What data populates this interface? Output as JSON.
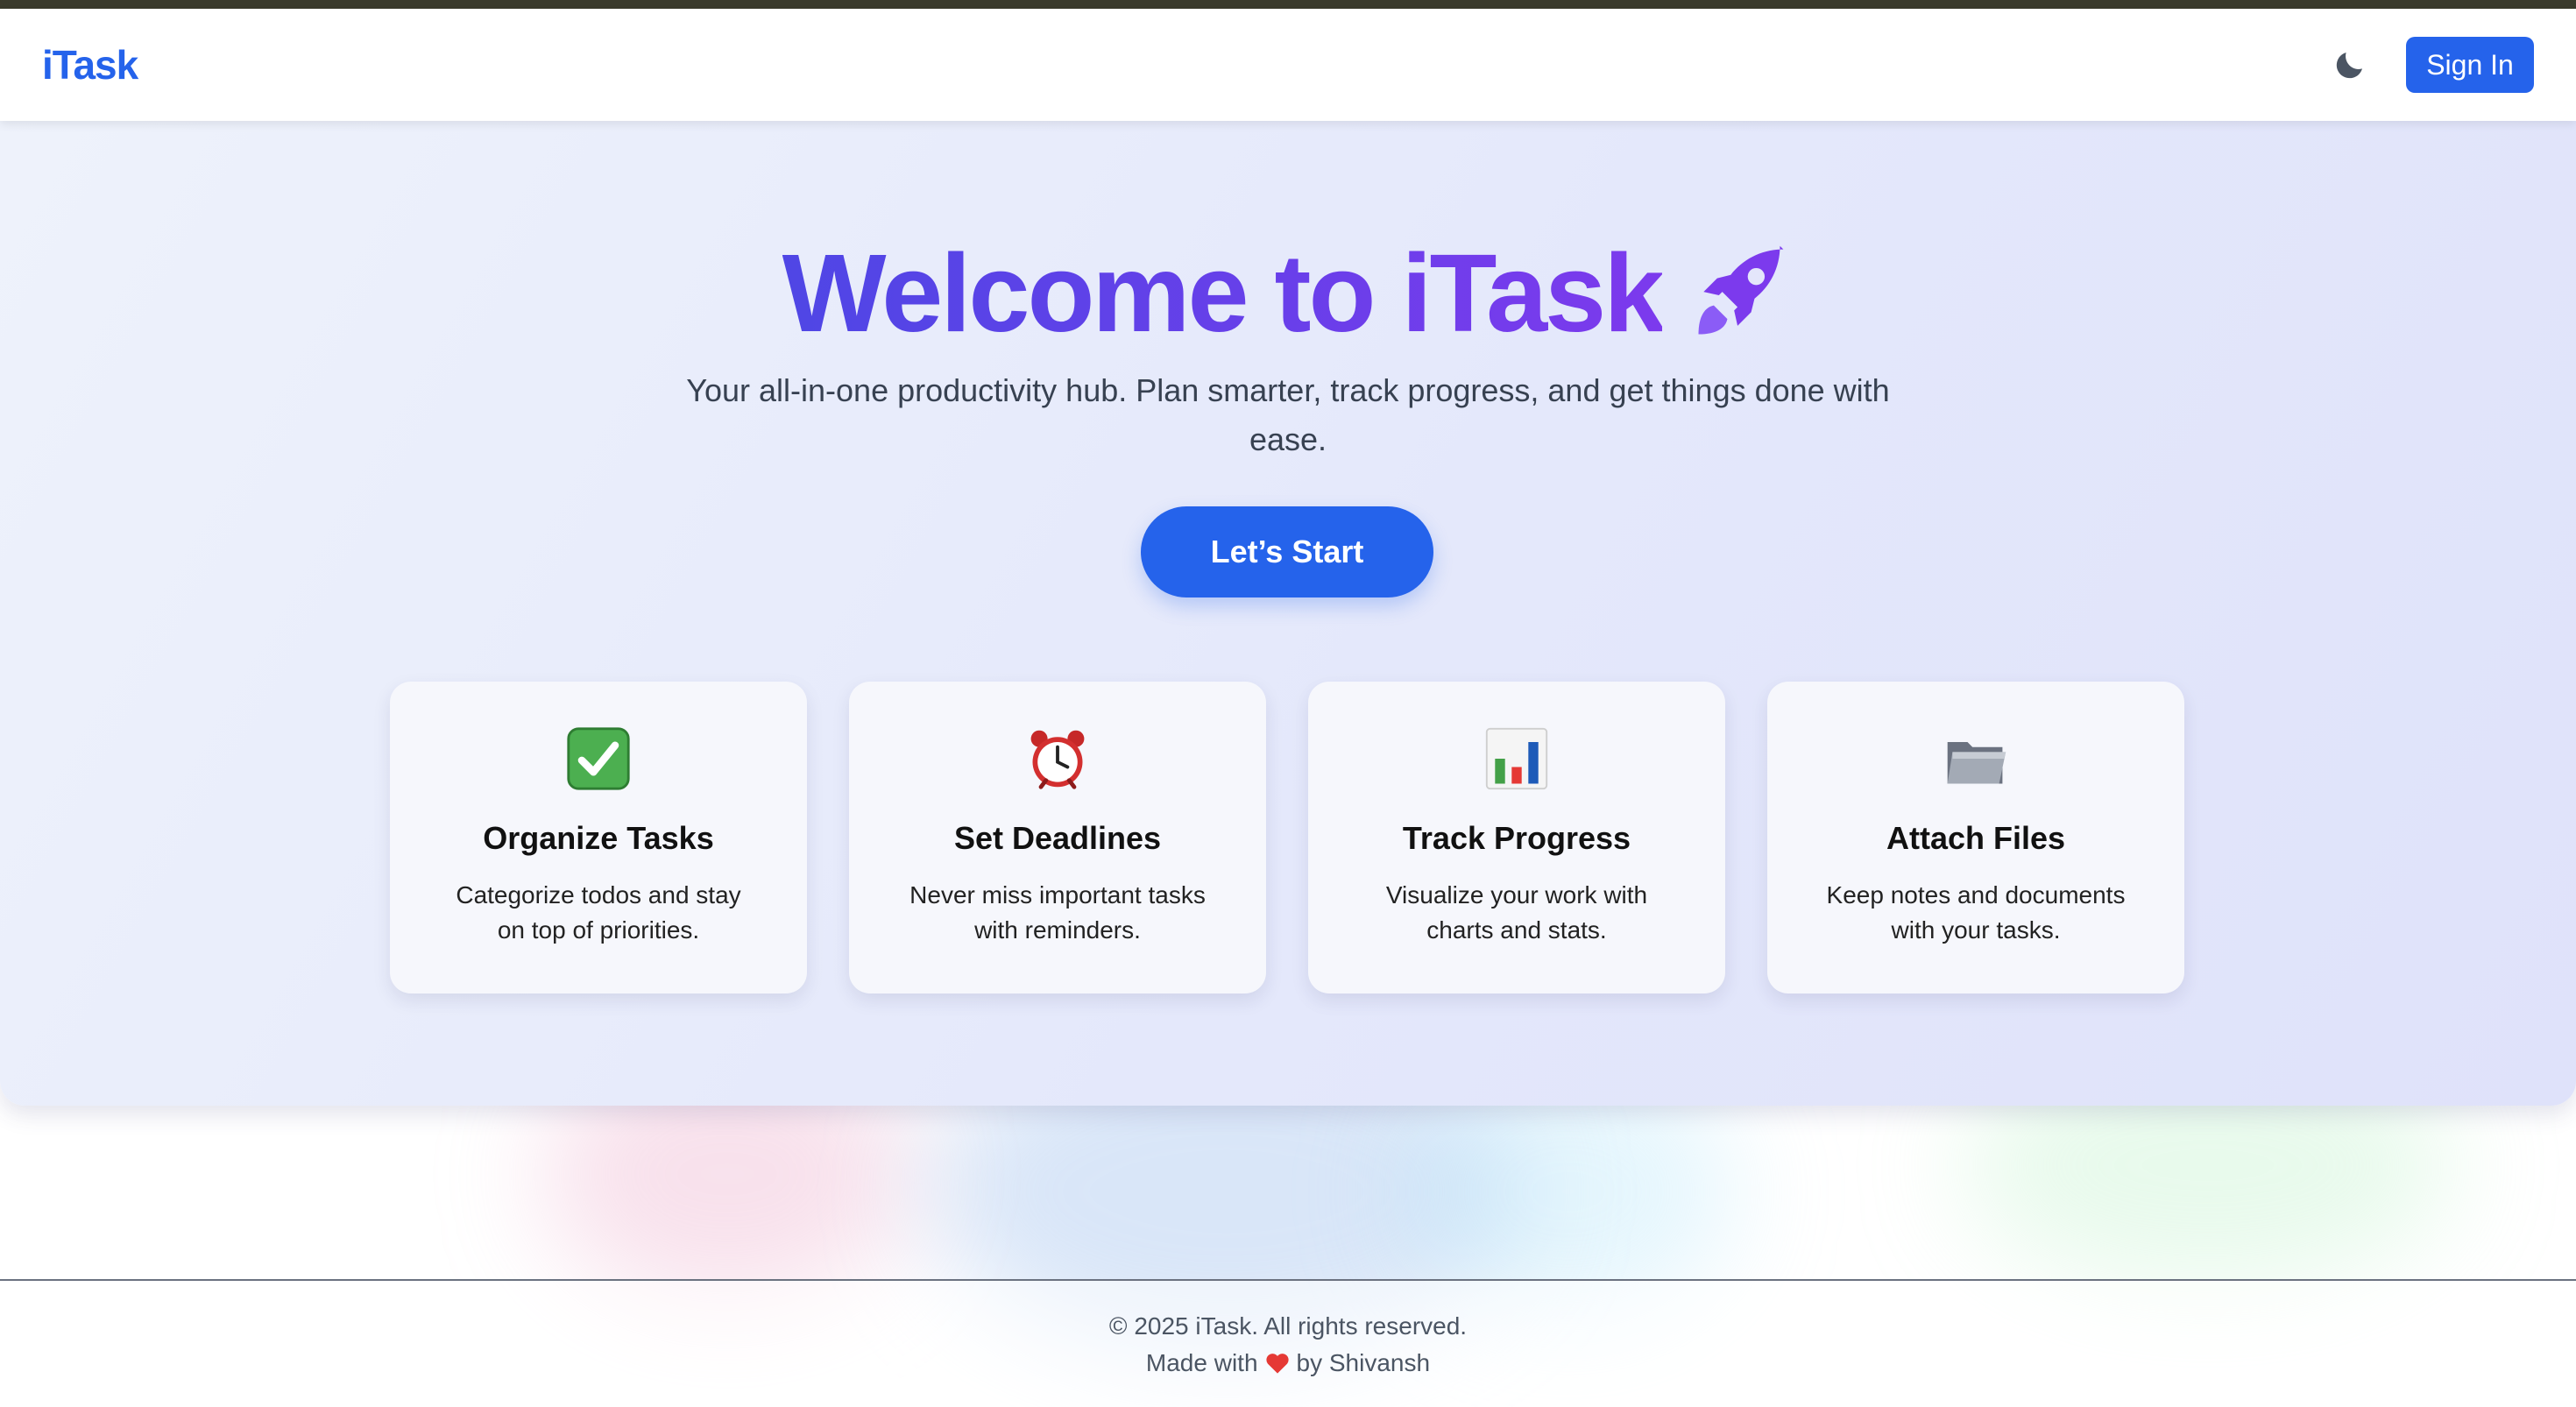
{
  "navbar": {
    "logo": "iTask",
    "theme_toggle_icon": "moon-icon",
    "signin_label": "Sign In"
  },
  "hero": {
    "title": "Welcome to iTask",
    "title_icon": "rocket-icon",
    "subtitle": "Your all-in-one productivity hub. Plan smarter, track progress, and get things done with ease.",
    "cta_label": "Let’s Start"
  },
  "features": [
    {
      "icon": "check-box-icon",
      "title": "Organize Tasks",
      "desc": "Categorize todos and stay on top of priorities."
    },
    {
      "icon": "alarm-clock-icon",
      "title": "Set Deadlines",
      "desc": "Never miss important tasks with reminders."
    },
    {
      "icon": "bar-chart-icon",
      "title": "Track Progress",
      "desc": "Visualize your work with charts and stats."
    },
    {
      "icon": "folder-icon",
      "title": "Attach Files",
      "desc": "Keep notes and documents with your tasks."
    }
  ],
  "footer": {
    "copyright": "© 2025 iTask. All rights reserved.",
    "made_with_prefix": "Made with",
    "made_with_suffix": "by Shivansh",
    "heart_icon": "heart-icon"
  },
  "colors": {
    "accent": "#2563eb",
    "title_gradient_start": "#4f46e5",
    "title_gradient_end": "#7c3aed"
  }
}
